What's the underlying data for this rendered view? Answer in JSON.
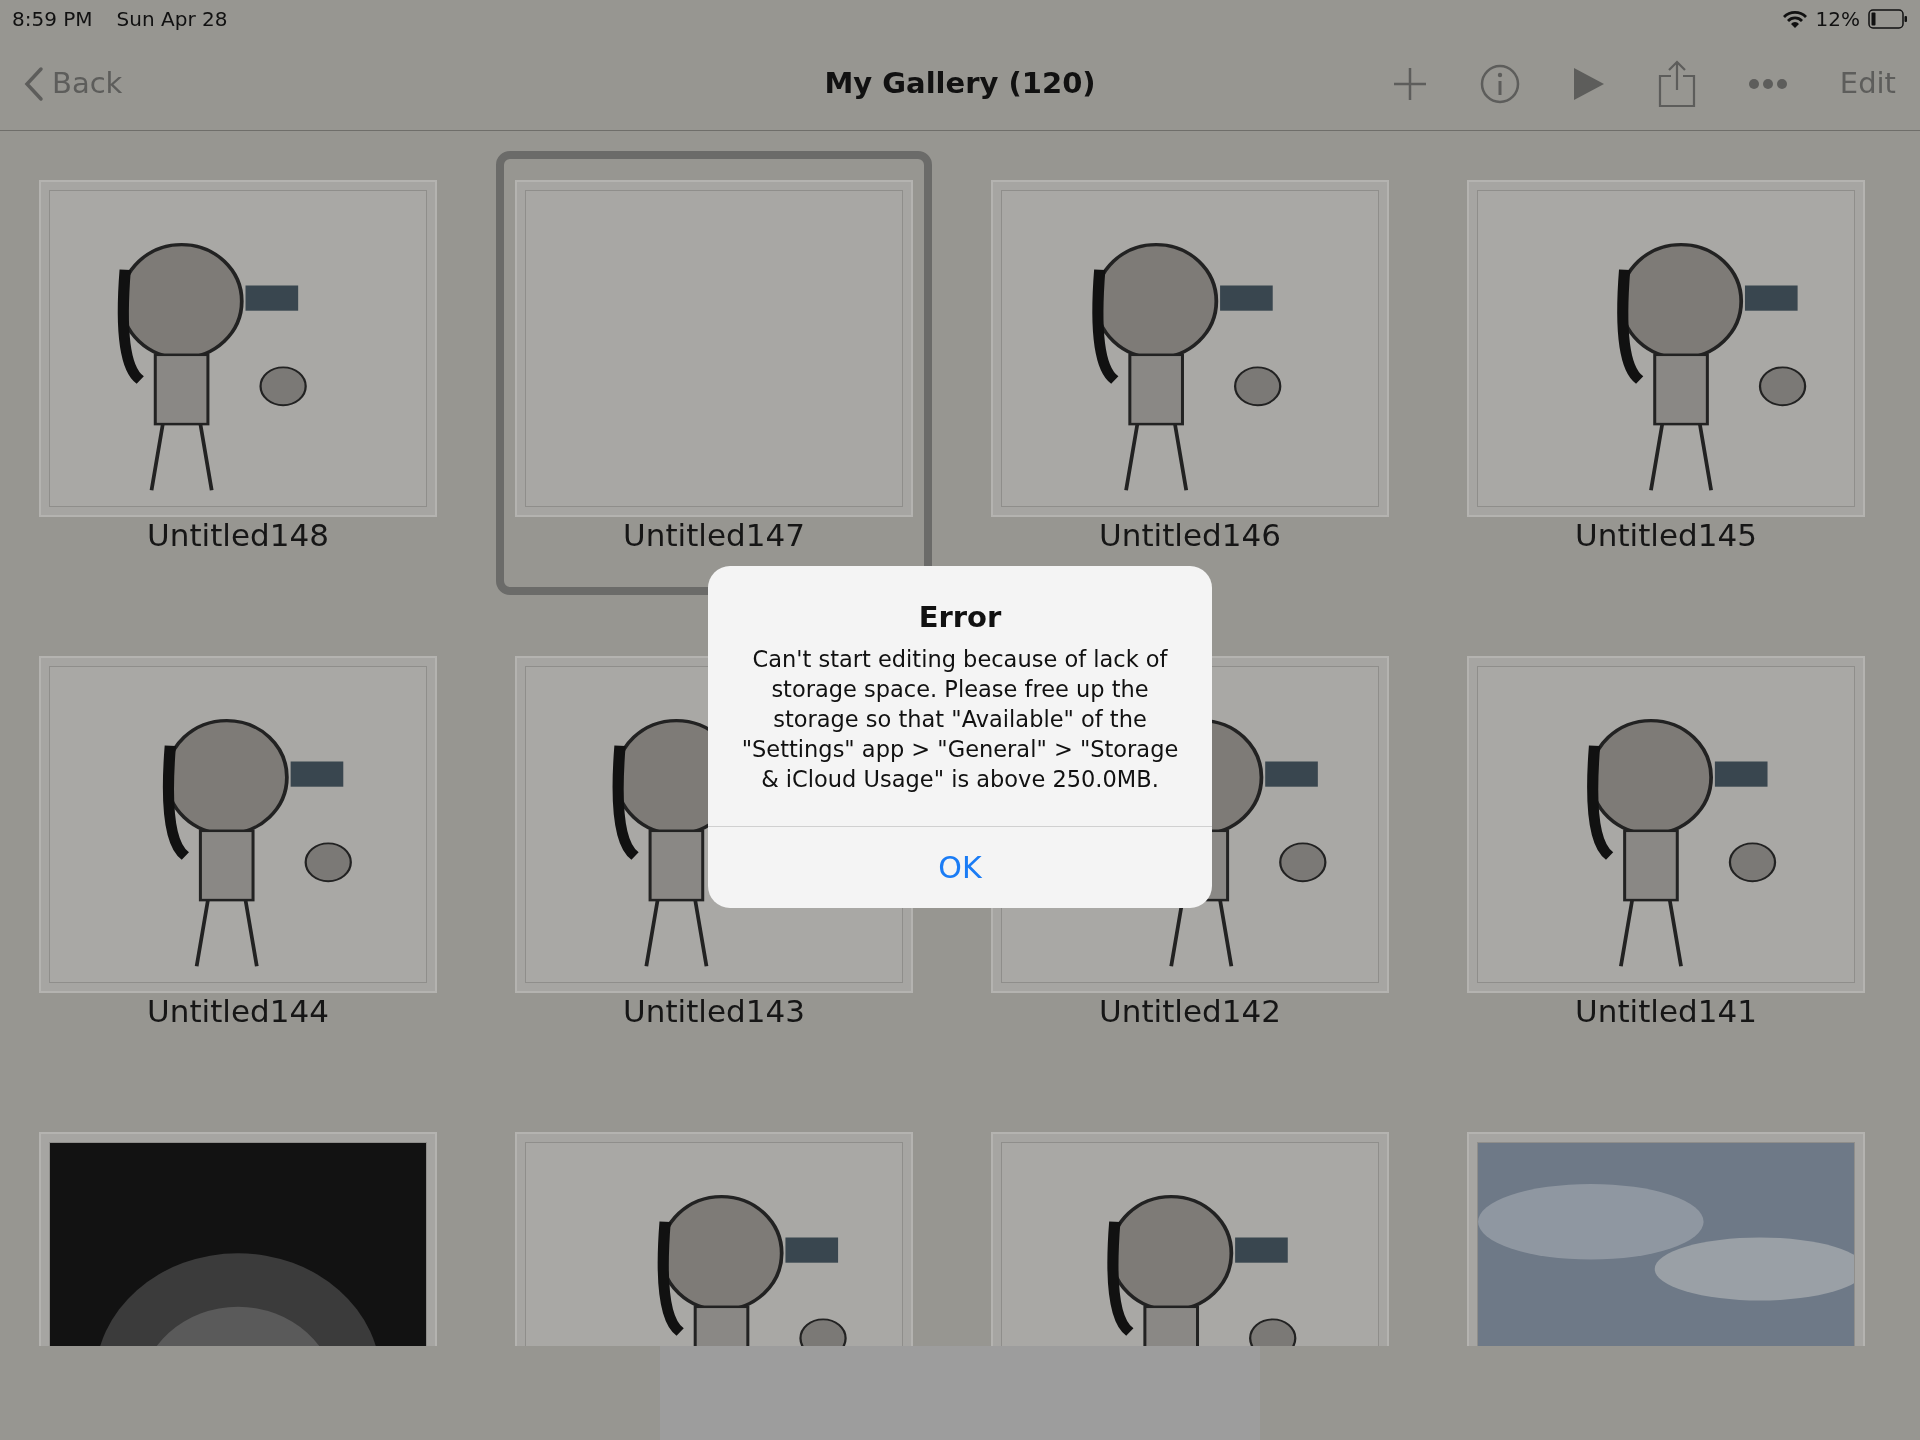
{
  "status_bar": {
    "time": "8:59 PM",
    "date": "Sun Apr 28",
    "battery": "12%"
  },
  "nav_bar": {
    "back": "Back",
    "title": "My Gallery (120)",
    "edit": "Edit"
  },
  "gallery": [
    {
      "title": "Untitled148",
      "selected": false,
      "kind": "sketch"
    },
    {
      "title": "Untitled147",
      "selected": true,
      "kind": "blank"
    },
    {
      "title": "Untitled146",
      "selected": false,
      "kind": "sketch"
    },
    {
      "title": "Untitled145",
      "selected": false,
      "kind": "sketch"
    },
    {
      "title": "Untitled144",
      "selected": false,
      "kind": "sketch"
    },
    {
      "title": "Untitled143",
      "selected": false,
      "kind": "sketch"
    },
    {
      "title": "Untitled142",
      "selected": false,
      "kind": "sketch"
    },
    {
      "title": "Untitled141",
      "selected": false,
      "kind": "sketch"
    },
    {
      "selected": false,
      "kind": "dark"
    },
    {
      "selected": false,
      "kind": "sketch"
    },
    {
      "selected": false,
      "kind": "sketch"
    },
    {
      "selected": false,
      "kind": "field"
    }
  ],
  "dialog": {
    "title": "Error",
    "message": "Can't start editing because of lack of storage space. Please free up the storage so that \"Available\" of the \"Settings\" app > \"General\" > \"Storage & iCloud Usage\" is above 250.0MB.",
    "buttons": [
      "OK"
    ]
  }
}
